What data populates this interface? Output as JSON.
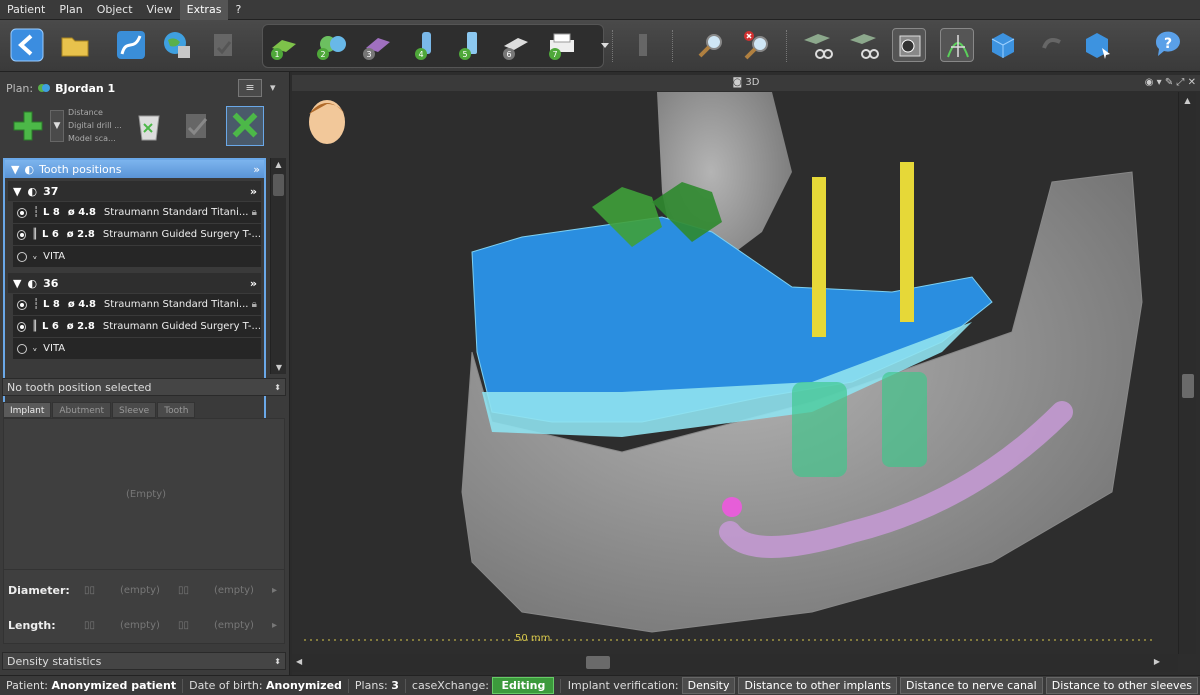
{
  "menu": [
    "Patient",
    "Plan",
    "Object",
    "View",
    "Extras",
    "?"
  ],
  "plan": {
    "label": "Plan:",
    "name": "BJordan 1"
  },
  "add_menu": [
    "Distance",
    "Digital drill ...",
    "Model sca..."
  ],
  "tooth_positions": {
    "title": "Tooth positions",
    "teeth": [
      {
        "number": "37",
        "rows": [
          {
            "length": "L 8",
            "diameter": "ø 4.8",
            "name": "Straumann Standard Titani...",
            "radio": true,
            "locked": true
          },
          {
            "length": "L 6",
            "diameter": "ø 2.8",
            "name": "Straumann Guided Surgery T-...",
            "radio": true,
            "locked": false
          },
          {
            "length": "",
            "diameter": "",
            "name": "VITA",
            "radio": false,
            "locked": false
          }
        ]
      },
      {
        "number": "36",
        "rows": [
          {
            "length": "L 8",
            "diameter": "ø 4.8",
            "name": "Straumann Standard Titani...",
            "radio": true,
            "locked": true
          },
          {
            "length": "L 6",
            "diameter": "ø 2.8",
            "name": "Straumann Guided Surgery T-...",
            "radio": true,
            "locked": false
          },
          {
            "length": "",
            "diameter": "",
            "name": "VITA",
            "radio": false,
            "locked": false
          }
        ]
      }
    ]
  },
  "selection": "No tooth position selected",
  "tabs": [
    "Implant",
    "Abutment",
    "Sleeve",
    "Tooth"
  ],
  "details": {
    "empty_center": "(Empty)",
    "diameter_label": "Diameter:",
    "length_label": "Length:",
    "empty_value": "(empty)"
  },
  "density_statistics": "Density statistics",
  "viewport": {
    "title": "3D",
    "scale_label": "50 mm"
  },
  "status": {
    "patient_label": "Patient:",
    "patient": "Anonymized patient",
    "dob_label": "Date of birth:",
    "dob": "Anonymized",
    "plans_label": "Plans:",
    "plans": "3",
    "casex_label": "caseXchange:",
    "casex": "Editing",
    "verify_label": "Implant verification:",
    "buttons": [
      "Density",
      "Distance to other implants",
      "Distance to nerve canal",
      "Distance to other sleeves"
    ]
  },
  "colors": {
    "accent": "#5a94d6",
    "editing": "#3c9a3c",
    "implant": "#e6d838",
    "teeth": "#2c8fe0",
    "nerve": "#c79ad6"
  }
}
